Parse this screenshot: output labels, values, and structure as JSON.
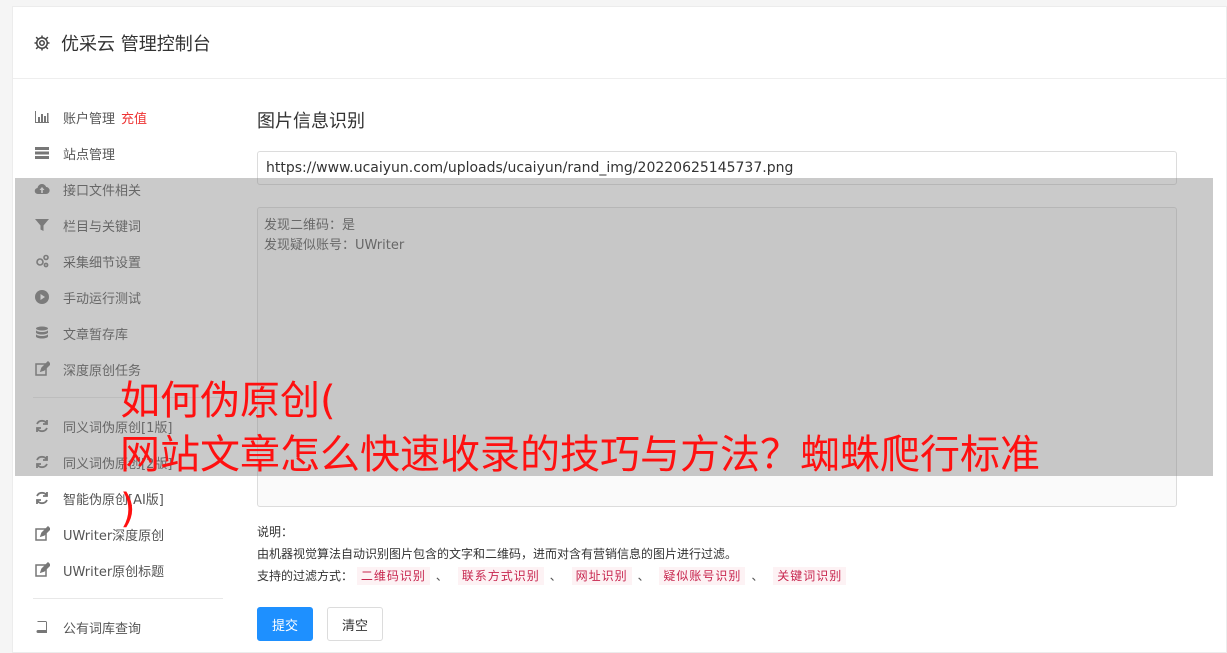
{
  "header": {
    "title": "优采云 管理控制台",
    "icon": "gear-icon"
  },
  "sidebar": {
    "items": [
      {
        "label": "账户管理",
        "extra": "充值",
        "icon": "bar-chart-icon"
      },
      {
        "label": "站点管理",
        "icon": "server-icon"
      },
      {
        "label": "接口文件相关",
        "icon": "cloud-upload-icon"
      },
      {
        "label": "栏目与关键词",
        "icon": "filter-icon"
      },
      {
        "label": "采集细节设置",
        "icon": "gears-icon"
      },
      {
        "label": "手动运行测试",
        "icon": "play-circle-icon"
      },
      {
        "label": "文章暂存库",
        "icon": "database-icon"
      },
      {
        "label": "深度原创任务",
        "icon": "edit-icon"
      },
      {
        "label": "同义词伪原创[1版]",
        "icon": "refresh-icon"
      },
      {
        "label": "同义词伪原创[2版]",
        "icon": "refresh-icon"
      },
      {
        "label": "智能伪原创[AI版]",
        "icon": "refresh-icon"
      },
      {
        "label": "UWriter深度原创",
        "icon": "edit-icon"
      },
      {
        "label": "UWriter原创标题",
        "icon": "edit-icon"
      },
      {
        "label": "公有词库查询",
        "icon": "book-icon"
      }
    ]
  },
  "main": {
    "title": "图片信息识别",
    "url_value": "https://www.ucaiyun.com/uploads/ucaiyun/rand_img/20220625145737.png",
    "result_lines": [
      "发现二维码：是",
      "发现疑似账号：UWriter"
    ],
    "notes_label": "说明：",
    "notes_desc": "由机器视觉算法自动识别图片包含的文字和二维码，进而对含有营销信息的图片进行过滤。",
    "filter_label": "支持的过滤方式：",
    "filters": [
      "二维码识别",
      "联系方式识别",
      "网址识别",
      "疑似账号识别",
      "关键词识别"
    ],
    "submit_label": "提交",
    "clear_label": "清空"
  },
  "overlay": {
    "text": "如何伪原创(\n网站文章怎么快速收录的技巧与方法？蜘蛛爬行标准\n)"
  },
  "colors": {
    "accent": "#1e90ff",
    "danger": "#e33333",
    "overlay_text": "#ff1010",
    "tag_text": "#c7254e"
  }
}
